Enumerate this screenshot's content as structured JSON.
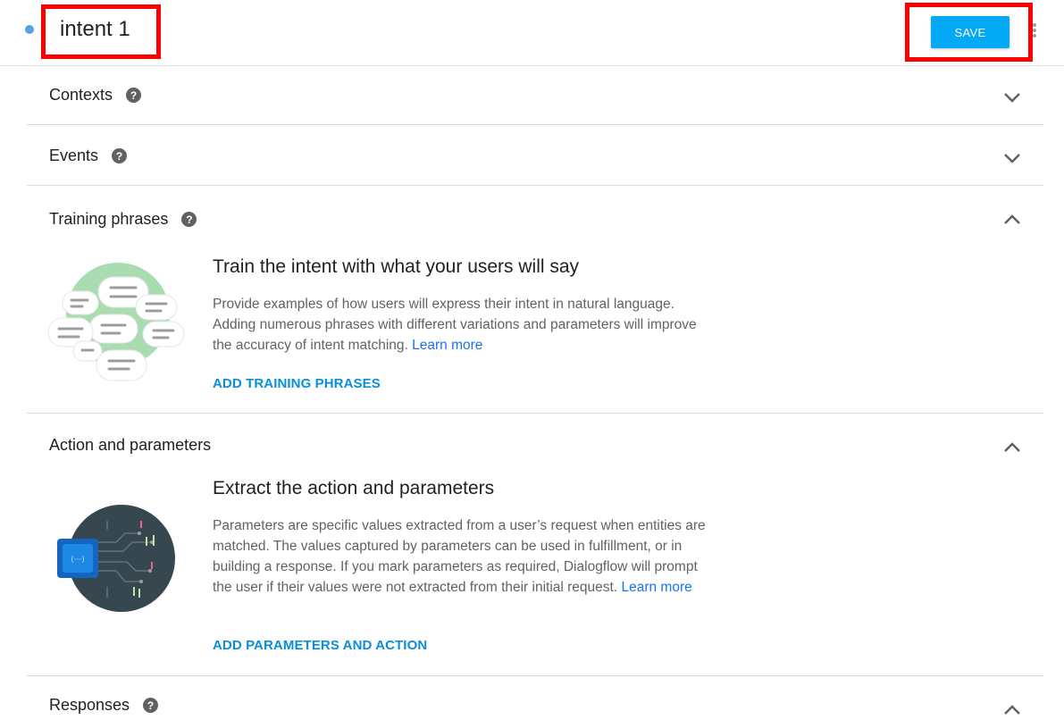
{
  "header": {
    "title": "intent 1",
    "save_label": "SAVE"
  },
  "sections": {
    "contexts": {
      "label": "Contexts",
      "help": "?",
      "state": "collapsed"
    },
    "events": {
      "label": "Events",
      "help": "?",
      "state": "collapsed"
    },
    "training": {
      "label": "Training phrases",
      "help": "?",
      "state": "expanded",
      "heading": "Train the intent with what your users will say",
      "description": "Provide examples of how users will express their intent in natural language. Adding numerous phrases with different variations and parameters will improve the accuracy of intent matching.",
      "learn_more": "Learn more",
      "action": "ADD TRAINING PHRASES"
    },
    "action_params": {
      "label": "Action and parameters",
      "state": "expanded",
      "heading": "Extract the action and parameters",
      "description": "Parameters are specific values extracted from a user’s request when entities are matched. The values captured by parameters can be used in fulfillment, or in building a response. If you mark parameters as required, Dialogflow will prompt the user if their values were not extracted from their initial request.",
      "learn_more": "Learn more",
      "action": "ADD PARAMETERS AND ACTION"
    },
    "responses": {
      "label": "Responses",
      "help": "?",
      "state": "expanded"
    }
  },
  "icons": {
    "help": "help-circle-icon",
    "chevron_down": "chevron-down-icon",
    "chevron_up": "chevron-up-icon",
    "more": "more-vert-icon"
  },
  "colors": {
    "accent": "#03a9f4",
    "link": "#1a73e8",
    "action_link": "#0b8ed8",
    "highlight": "#ff0000"
  }
}
